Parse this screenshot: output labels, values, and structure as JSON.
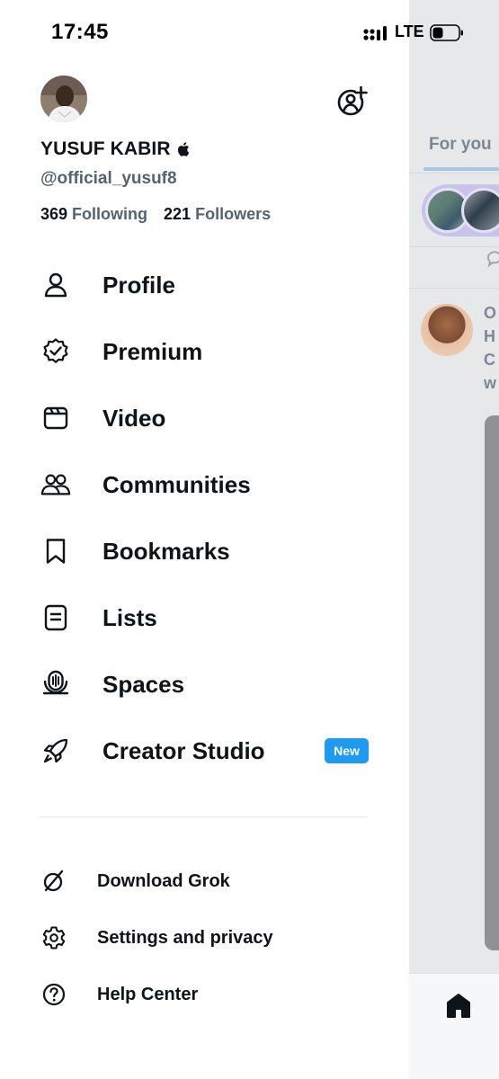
{
  "status_bar": {
    "time": "17:45",
    "network": "LTE",
    "icons": [
      "signal-icon",
      "battery-icon"
    ]
  },
  "profile": {
    "display_name": "YUSUF KABIR",
    "handle": "@official_yusuf8",
    "following_count": "369",
    "following_label": "Following",
    "followers_count": "221",
    "followers_label": "Followers"
  },
  "nav": {
    "items": [
      {
        "label": "Profile",
        "icon": "person-icon"
      },
      {
        "label": "Premium",
        "icon": "verified-badge-icon"
      },
      {
        "label": "Video",
        "icon": "video-icon"
      },
      {
        "label": "Communities",
        "icon": "communities-icon"
      },
      {
        "label": "Bookmarks",
        "icon": "bookmark-icon"
      },
      {
        "label": "Lists",
        "icon": "list-icon"
      },
      {
        "label": "Spaces",
        "icon": "spaces-icon"
      },
      {
        "label": "Creator Studio",
        "icon": "rocket-icon",
        "badge": "New"
      }
    ]
  },
  "secondary": {
    "items": [
      {
        "label": "Download Grok",
        "icon": "grok-icon"
      },
      {
        "label": "Settings and privacy",
        "icon": "gear-icon"
      },
      {
        "label": "Help Center",
        "icon": "help-icon"
      }
    ]
  },
  "feed": {
    "tab_label": "For you",
    "post_text_fragment": [
      "O",
      "H",
      "C",
      "w"
    ]
  },
  "colors": {
    "accent": "#1d9bf0",
    "text_primary": "#0f1419",
    "text_secondary": "#536471",
    "overlay": "#e6e8ea"
  }
}
